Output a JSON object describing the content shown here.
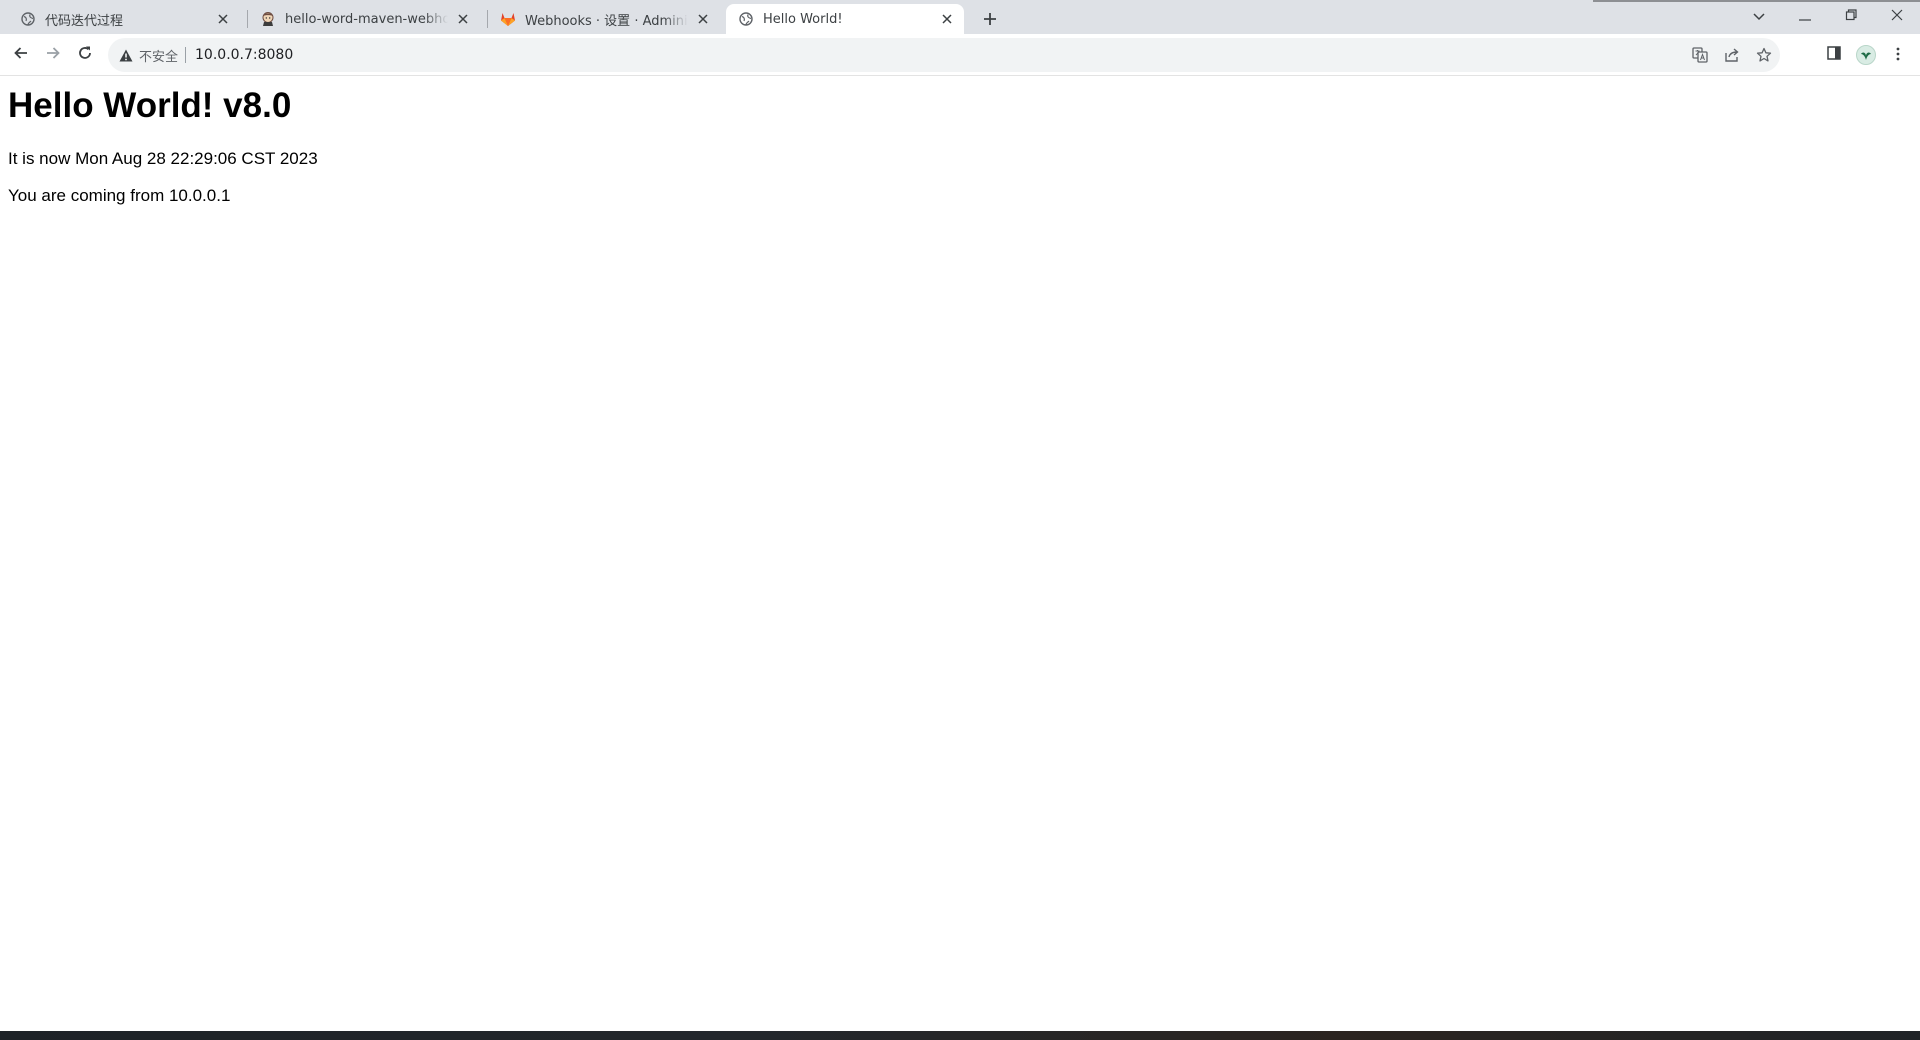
{
  "tabs": [
    {
      "title": "代码迭代过程",
      "favicon": "globe-icon",
      "active": false
    },
    {
      "title": "hello-word-maven-webhook [",
      "favicon": "jenkins-icon",
      "active": false
    },
    {
      "title": "Webhooks · 设置 · Administrat",
      "favicon": "gitlab-icon",
      "active": false
    },
    {
      "title": "Hello World!",
      "favicon": "globe-icon",
      "active": true
    }
  ],
  "toolbar": {
    "security_label": "不安全",
    "url": "10.0.0.7:8080"
  },
  "page": {
    "heading": "Hello World! v8.0",
    "line1": "It is now Mon Aug 28 22:29:06 CST 2023",
    "line2": "You are coming from 10.0.0.1"
  },
  "colors": {
    "tabstrip_bg": "#dee1e6",
    "omnibox_bg": "#f1f3f4",
    "gitlab_orange": "#e24329"
  }
}
